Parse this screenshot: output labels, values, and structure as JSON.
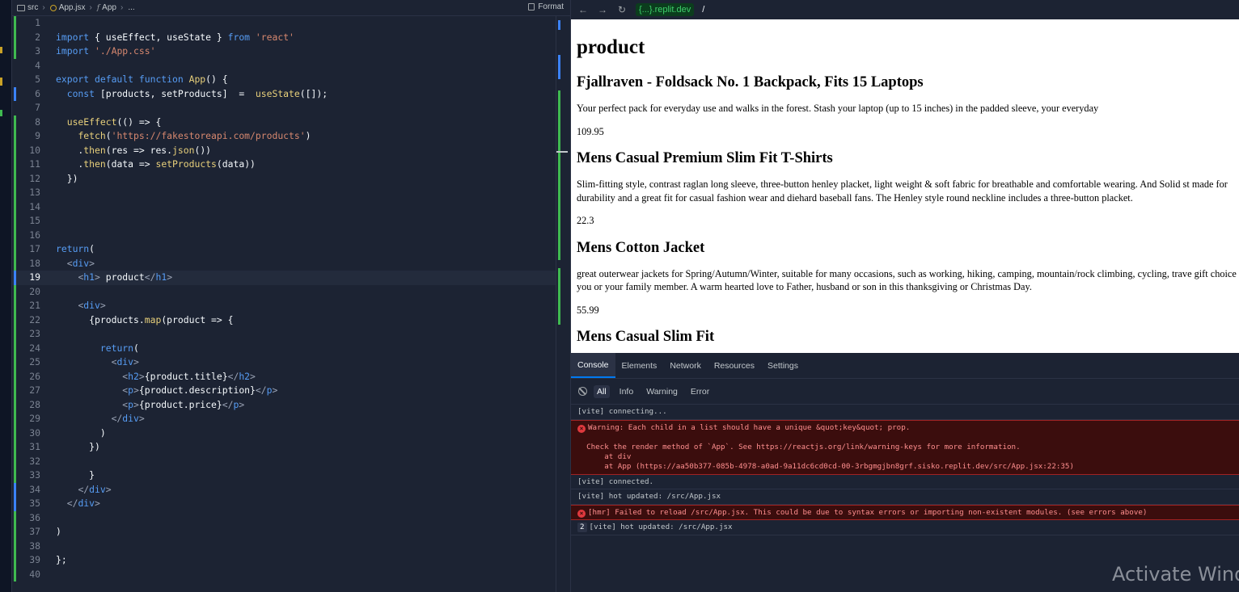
{
  "editor": {
    "breadcrumb": [
      "src",
      "App.jsx",
      "App",
      "..."
    ],
    "format_label": "Format",
    "active_line": 19,
    "lines": [
      {
        "n": "1",
        "html": ""
      },
      {
        "n": "2",
        "html": "<span class=\"kw\">import</span> { useEffect, useState } <span class=\"kw\">from</span> <span class=\"str\">'react'</span>"
      },
      {
        "n": "3",
        "html": "<span class=\"kw\">import</span> <span class=\"str\">'./App.css'</span>"
      },
      {
        "n": "4",
        "html": ""
      },
      {
        "n": "5",
        "html": "<span class=\"kw\">export default function</span> <span class=\"fn\">App</span>() {"
      },
      {
        "n": "6",
        "html": "  <span class=\"kw\">const</span> [products, setProducts]  =  <span class=\"fn\">useState</span>([]);"
      },
      {
        "n": "7",
        "html": ""
      },
      {
        "n": "8",
        "html": "  <span class=\"fn\">useEffect</span>(() => {"
      },
      {
        "n": "9",
        "html": "    <span class=\"fn\">fetch</span>(<span class=\"str\">'https://fakestoreapi.com/products'</span>)"
      },
      {
        "n": "10",
        "html": "    .<span class=\"fn\">then</span>(res => res.<span class=\"fn\">json</span>())"
      },
      {
        "n": "11",
        "html": "    .<span class=\"fn\">then</span>(data => <span class=\"fn\">setProducts</span>(data))"
      },
      {
        "n": "12",
        "html": "  })"
      },
      {
        "n": "13",
        "html": ""
      },
      {
        "n": "14",
        "html": ""
      },
      {
        "n": "15",
        "html": ""
      },
      {
        "n": "16",
        "html": ""
      },
      {
        "n": "17",
        "html": "<span class=\"kw\">return</span>("
      },
      {
        "n": "18",
        "html": "  <span class=\"tag\">&lt;</span><span class=\"kw\">div</span><span class=\"tag\">&gt;</span>"
      },
      {
        "n": "19",
        "html": "    <span class=\"tag\">&lt;</span><span class=\"kw\">h1</span><span class=\"tag\">&gt;</span> product<span class=\"tag\">&lt;/</span><span class=\"kw\">h1</span><span class=\"tag\">&gt;</span>"
      },
      {
        "n": "20",
        "html": ""
      },
      {
        "n": "21",
        "html": "    <span class=\"tag\">&lt;</span><span class=\"kw\">div</span><span class=\"tag\">&gt;</span>"
      },
      {
        "n": "22",
        "html": "      {products.<span class=\"fn\">map</span>(product => {"
      },
      {
        "n": "23",
        "html": ""
      },
      {
        "n": "24",
        "html": "        <span class=\"kw\">return</span>("
      },
      {
        "n": "25",
        "html": "          <span class=\"tag\">&lt;</span><span class=\"kw\">div</span><span class=\"tag\">&gt;</span>"
      },
      {
        "n": "26",
        "html": "            <span class=\"tag\">&lt;</span><span class=\"kw\">h2</span><span class=\"tag\">&gt;</span>{product.title}<span class=\"tag\">&lt;/</span><span class=\"kw\">h2</span><span class=\"tag\">&gt;</span>"
      },
      {
        "n": "27",
        "html": "            <span class=\"tag\">&lt;</span><span class=\"kw\">p</span><span class=\"tag\">&gt;</span>{product.description}<span class=\"tag\">&lt;/</span><span class=\"kw\">p</span><span class=\"tag\">&gt;</span>"
      },
      {
        "n": "28",
        "html": "            <span class=\"tag\">&lt;</span><span class=\"kw\">p</span><span class=\"tag\">&gt;</span>{product.price}<span class=\"tag\">&lt;/</span><span class=\"kw\">p</span><span class=\"tag\">&gt;</span>"
      },
      {
        "n": "29",
        "html": "          <span class=\"tag\">&lt;/</span><span class=\"kw\">div</span><span class=\"tag\">&gt;</span>"
      },
      {
        "n": "30",
        "html": "        )"
      },
      {
        "n": "31",
        "html": "      })"
      },
      {
        "n": "32",
        "html": ""
      },
      {
        "n": "33",
        "html": "      }"
      },
      {
        "n": "34",
        "html": "    <span class=\"tag\">&lt;/</span><span class=\"kw\">div</span><span class=\"tag\">&gt;</span>"
      },
      {
        "n": "35",
        "html": "  <span class=\"tag\">&lt;/</span><span class=\"kw\">div</span><span class=\"tag\">&gt;</span>"
      },
      {
        "n": "36",
        "html": ""
      },
      {
        "n": "37",
        "html": ")"
      },
      {
        "n": "38",
        "html": ""
      },
      {
        "n": "39",
        "html": "};"
      },
      {
        "n": "40",
        "html": ""
      }
    ]
  },
  "browser": {
    "url_host": "{...}.replit.dev",
    "url_path": "/",
    "page_heading": "product",
    "products": [
      {
        "title": "Fjallraven - Foldsack No. 1 Backpack, Fits 15 Laptops",
        "description": "Your perfect pack for everyday use and walks in the forest. Stash your laptop (up to 15 inches) in the padded sleeve, your everyday",
        "price": "109.95"
      },
      {
        "title": "Mens Casual Premium Slim Fit T-Shirts",
        "description": "Slim-fitting style, contrast raglan long sleeve, three-button henley placket, light weight & soft fabric for breathable and comfortable wearing. And Solid st made for durability and a great fit for casual fashion wear and diehard baseball fans. The Henley style round neckline includes a three-button placket.",
        "price": "22.3"
      },
      {
        "title": "Mens Cotton Jacket",
        "description": "great outerwear jackets for Spring/Autumn/Winter, suitable for many occasions, such as working, hiking, camping, mountain/rock climbing, cycling, trave gift choice for you or your family member. A warm hearted love to Father, husband or son in this thanksgiving or Christmas Day.",
        "price": "55.99"
      },
      {
        "title": "Mens Casual Slim Fit",
        "description": "",
        "price": ""
      }
    ]
  },
  "devtools": {
    "tabs": [
      "Console",
      "Elements",
      "Network",
      "Resources",
      "Settings"
    ],
    "filters": [
      "All",
      "Info",
      "Warning",
      "Error"
    ],
    "logs": [
      {
        "type": "info",
        "text": "[vite] connecting..."
      },
      {
        "type": "error",
        "text": "Warning: Each child in a list should have a unique &quot;key&quot; prop.\n\n  Check the render method of `App`. See https://reactjs.org/link/warning-keys for more information.\n      at div\n      at App (https://aa50b377-085b-4978-a0ad-9a11dc6cd0cd-00-3rbgmgjbn8grf.sisko.replit.dev/src/App.jsx:22:35)"
      },
      {
        "type": "info",
        "text": "[vite] connected."
      },
      {
        "type": "info",
        "text": "[vite] hot updated: /src/App.jsx"
      },
      {
        "type": "error",
        "text": "[hmr] Failed to reload /src/App.jsx. This could be due to syntax errors or importing non-existent modules. (see errors above)"
      },
      {
        "type": "repeat",
        "count": "2",
        "text": "[vite] hot updated: /src/App.jsx"
      }
    ]
  },
  "watermark": "Activate Windo",
  "colors": {
    "editor_bg": "#1c2333",
    "keyword": "#579df5",
    "string": "#d7886f",
    "function": "#e8d07b",
    "error_bg": "#3b0d0d",
    "error_text": "#ff8f8f",
    "url_green": "#3fd06b"
  }
}
